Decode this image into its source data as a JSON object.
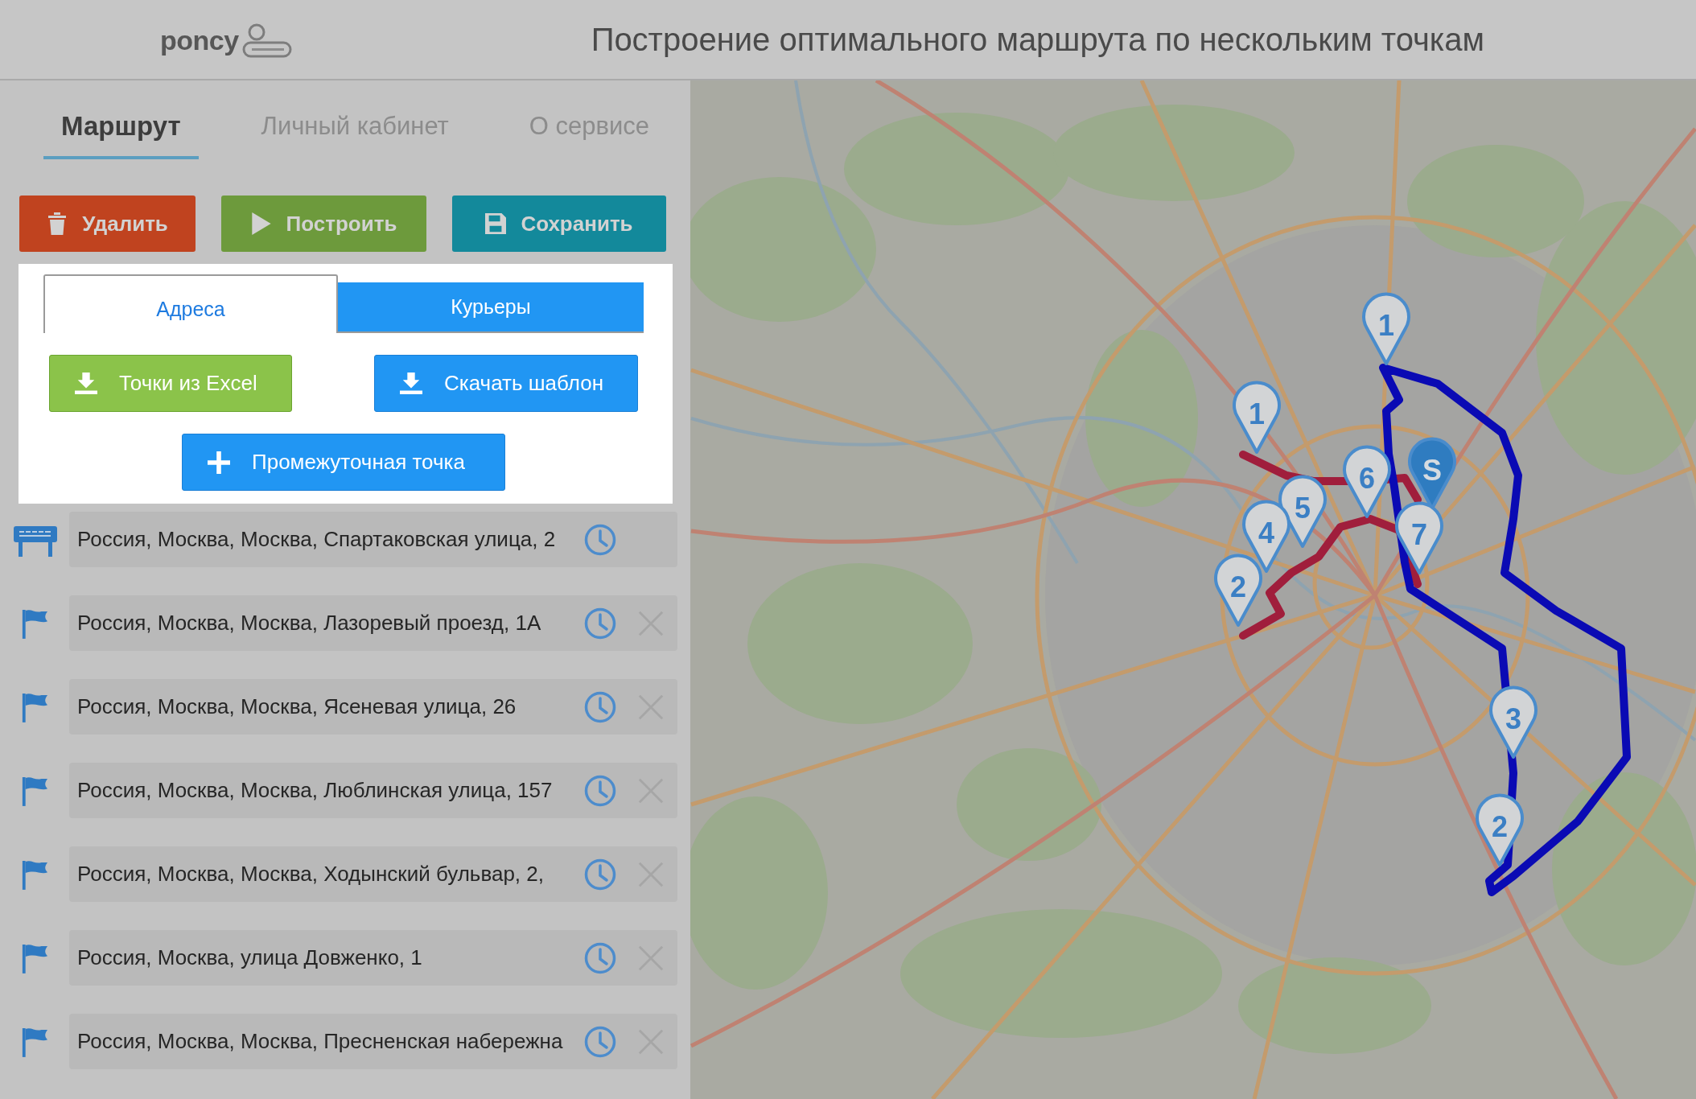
{
  "header": {
    "logo": "poncy",
    "title": "Построение оптимального маршрута по нескольким точкам"
  },
  "nav_tabs": [
    {
      "label": "Маршрут",
      "selected": true
    },
    {
      "label": "Личный кабинет",
      "selected": false
    },
    {
      "label": "О сервисе",
      "selected": false
    }
  ],
  "actions": [
    {
      "label": "Удалить",
      "kind": "delete"
    },
    {
      "label": "Построить",
      "kind": "build"
    },
    {
      "label": "Сохранить",
      "kind": "save"
    }
  ],
  "panel": {
    "tabs": [
      {
        "label": "Адреса",
        "selected": true
      },
      {
        "label": "Курьеры",
        "selected": false
      }
    ],
    "buttons": [
      {
        "label": "Точки из Excel",
        "kind": "import"
      },
      {
        "label": "Скачать шаблон",
        "kind": "download"
      },
      {
        "label": "Промежуточная точка",
        "kind": "add"
      }
    ]
  },
  "addresses": [
    {
      "kind": "start",
      "value": "Россия, Москва, Москва, Спартаковская улица, 2"
    },
    {
      "kind": "point",
      "value": "Россия, Москва, Москва, Лазоревый проезд, 1А"
    },
    {
      "kind": "point",
      "value": "Россия, Москва, Москва, Ясеневая улица, 26"
    },
    {
      "kind": "point",
      "value": "Россия, Москва, Москва, Люблинская улица, 157"
    },
    {
      "kind": "point",
      "value": "Россия, Москва, Москва, Ходынский бульвар, 2,"
    },
    {
      "kind": "point",
      "value": "Россия, Москва, улица Довженко, 1"
    },
    {
      "kind": "point",
      "value": "Россия, Москва, Москва, Пресненская набережна"
    }
  ],
  "map": {
    "routes": [
      {
        "color": "#a01e3c"
      },
      {
        "color": "#0a0ab4"
      }
    ],
    "markers": [
      {
        "label": "1",
        "kind": "pin"
      },
      {
        "label": "1",
        "kind": "pin"
      },
      {
        "label": "S",
        "kind": "start"
      },
      {
        "label": "6",
        "kind": "pin"
      },
      {
        "label": "5",
        "kind": "pin"
      },
      {
        "label": "7",
        "kind": "pin"
      },
      {
        "label": "4",
        "kind": "pin"
      },
      {
        "label": "2",
        "kind": "pin"
      },
      {
        "label": "3",
        "kind": "pin"
      },
      {
        "label": "2",
        "kind": "pin"
      }
    ]
  }
}
